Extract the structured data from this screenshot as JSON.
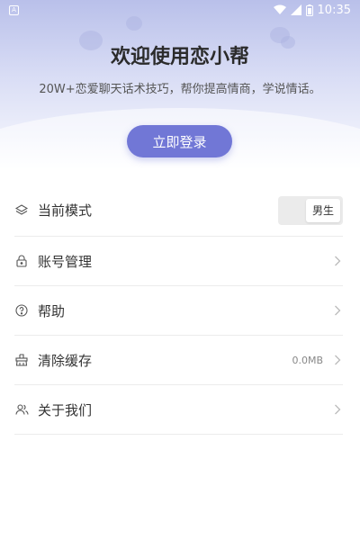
{
  "status_bar": {
    "time": "10:35",
    "app_icon_letter": "A"
  },
  "header": {
    "title": "欢迎使用恋小帮",
    "subtitle": "20W+恋爱聊天话术技巧，帮你提高情商，学说情话。",
    "login_button": "立即登录"
  },
  "menu": [
    {
      "label": "当前模式",
      "icon": "layers-icon",
      "toggle_value": "男生"
    },
    {
      "label": "账号管理",
      "icon": "lock-icon"
    },
    {
      "label": "帮助",
      "icon": "help-circle-icon"
    },
    {
      "label": "清除缓存",
      "icon": "broom-icon",
      "value": "0.0MB"
    },
    {
      "label": "关于我们",
      "icon": "users-icon"
    }
  ],
  "colors": {
    "accent": "#7177d6",
    "header_top": "#b9c0ea"
  }
}
